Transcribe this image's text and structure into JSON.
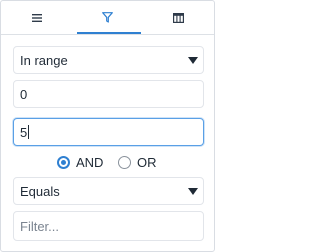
{
  "tabs": [
    {
      "id": "general",
      "icon": "menu-icon",
      "active": false
    },
    {
      "id": "filter",
      "icon": "filter-icon",
      "active": true
    },
    {
      "id": "columns",
      "icon": "columns-icon",
      "active": false
    }
  ],
  "filter1": {
    "operator": "In range",
    "from_value": "0",
    "to_value": "5"
  },
  "join": {
    "options": [
      "AND",
      "OR"
    ],
    "selected": "AND"
  },
  "filter2": {
    "operator": "Equals",
    "value": "",
    "placeholder": "Filter..."
  },
  "colors": {
    "accent": "#2f80d1",
    "border": "#e2e5ea",
    "text": "#1f2a36"
  }
}
